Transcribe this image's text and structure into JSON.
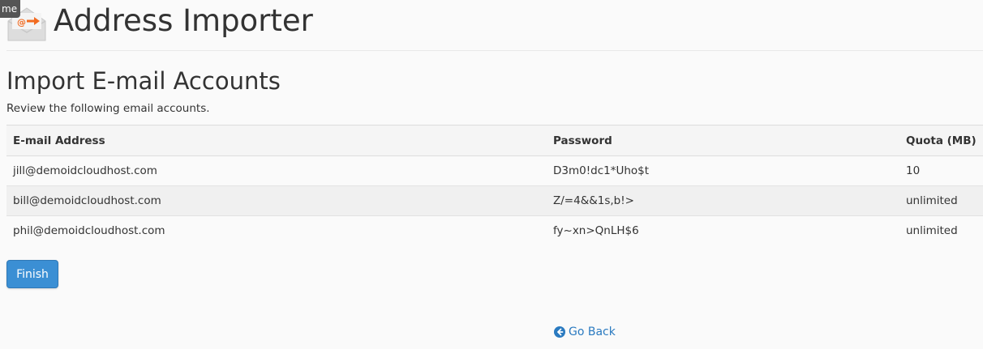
{
  "tooltip": {
    "text": "me"
  },
  "header": {
    "title": "Address Importer",
    "icon": "envelope-import-icon"
  },
  "section": {
    "title": "Import E-mail Accounts",
    "description": "Review the following email accounts."
  },
  "table": {
    "headers": {
      "email": "E-mail Address",
      "password": "Password",
      "quota": "Quota (MB)"
    },
    "rows": [
      {
        "email": "jill@demoidcloudhost.com",
        "password": "D3m0!dc1*Uho$t",
        "quota": "10"
      },
      {
        "email": "bill@demoidcloudhost.com",
        "password": "Z/=4&&1s,b!>",
        "quota": "unlimited"
      },
      {
        "email": "phil@demoidcloudhost.com",
        "password": "fy~xn>QnLH$6",
        "quota": "unlimited"
      }
    ]
  },
  "actions": {
    "finish_label": "Finish",
    "go_back_label": "Go Back"
  },
  "colors": {
    "primary_button": "#3b8fd4",
    "link": "#2a7ac0",
    "icon_accent": "#f26b21"
  }
}
